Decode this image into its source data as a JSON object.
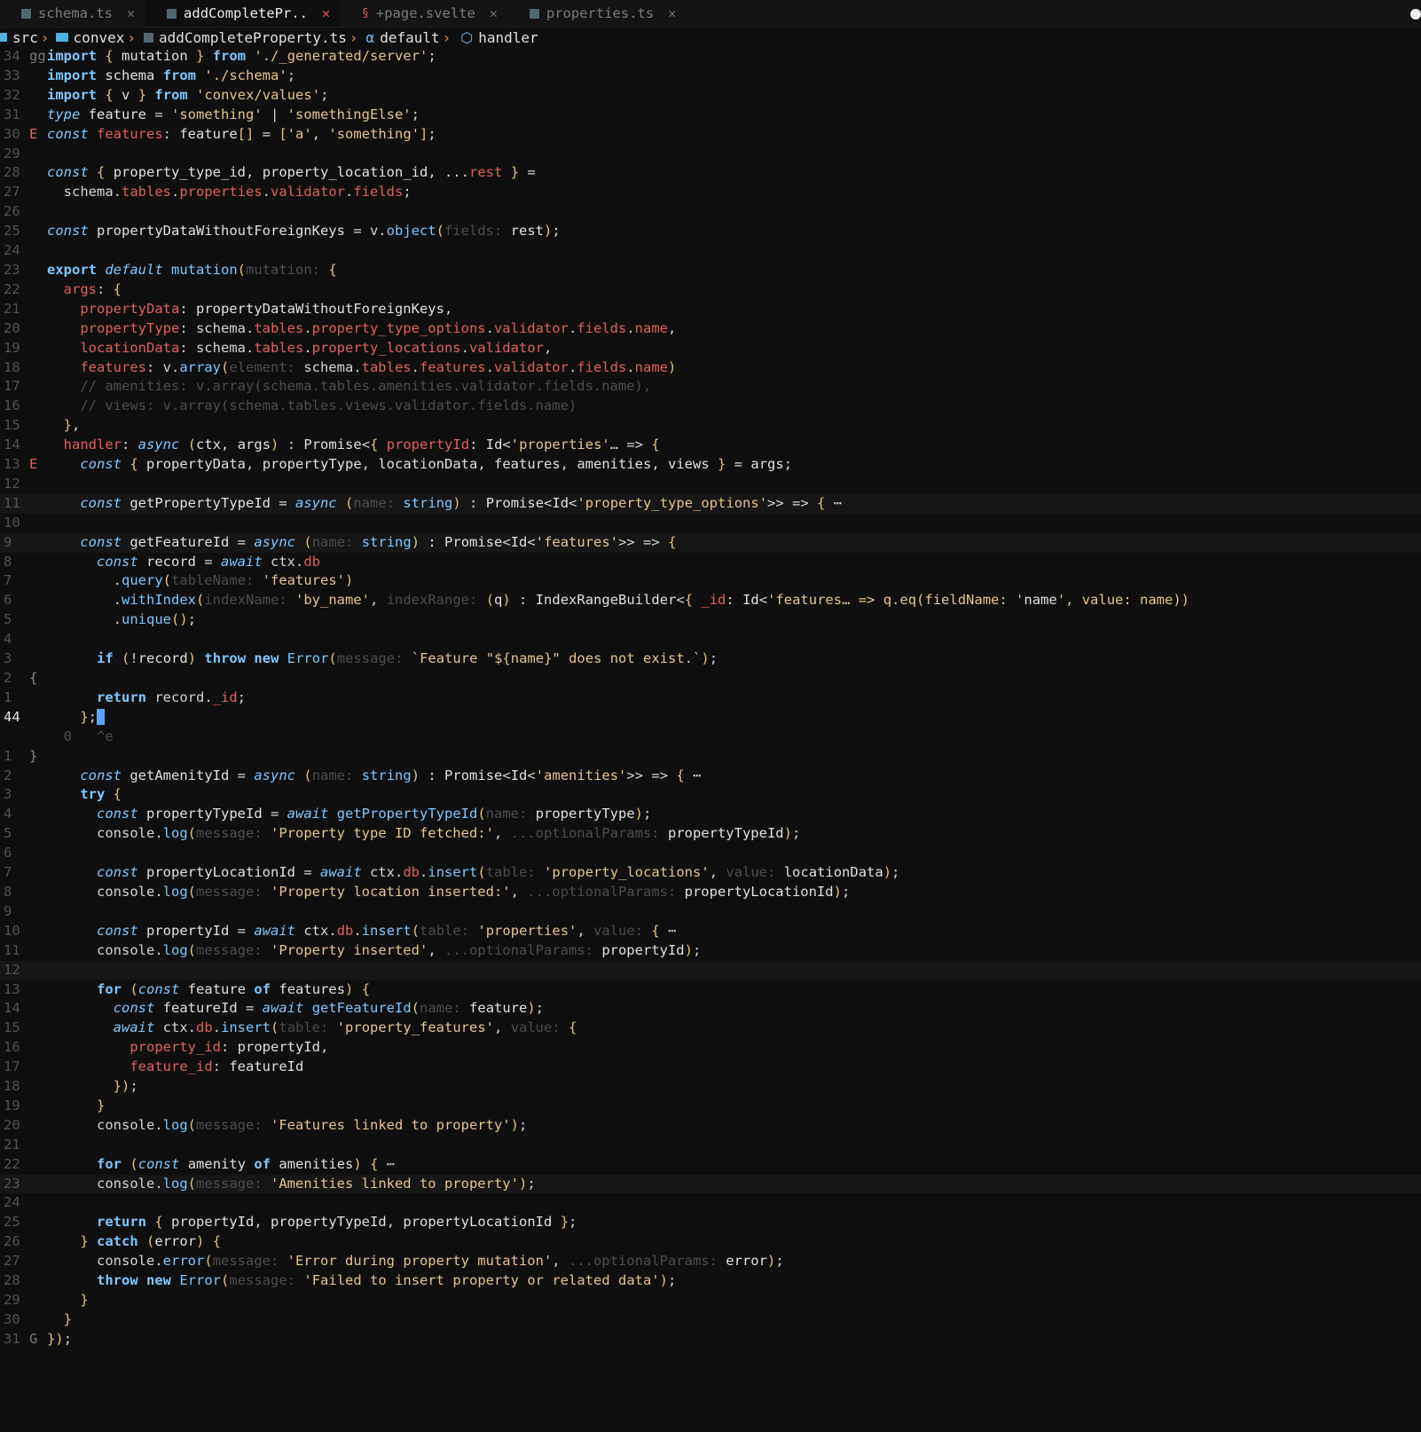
{
  "tabs": [
    {
      "label": "schema.ts",
      "icon": "ts-icon",
      "active": false
    },
    {
      "label": "addCompletePr..",
      "icon": "ts-icon",
      "active": true
    },
    {
      "label": "+page.svelte",
      "icon": "svelte-icon",
      "active": false
    },
    {
      "label": "properties.ts",
      "icon": "ts-icon",
      "active": false
    }
  ],
  "breadcrumb": {
    "src": "src",
    "folder": "convex",
    "file": "addCompleteProperty.ts",
    "symbol1": "default",
    "symbol2": "handler"
  },
  "colors": {
    "background": "#0f0f0f",
    "keyword": "#7fc7ff",
    "string": "#e5c48e",
    "property": "#e0605a",
    "cursor": "#5aa5ff"
  },
  "lines": [
    {
      "n": "34",
      "g": "gg",
      "t": "import { mutation } from './_generated/server';"
    },
    {
      "n": "33",
      "g": "",
      "t": "import schema from './schema';"
    },
    {
      "n": "32",
      "g": "",
      "t": "import { v } from 'convex/values';"
    },
    {
      "n": "31",
      "g": "",
      "t": "type feature = 'something' | 'somethingElse';"
    },
    {
      "n": "30",
      "g": "E",
      "t": "const features: feature[] = ['a', 'something'];"
    },
    {
      "n": "29",
      "g": "",
      "t": ""
    },
    {
      "n": "28",
      "g": "",
      "t": "const { property_type_id, property_location_id, ...rest } ="
    },
    {
      "n": "27",
      "g": "",
      "t": "  schema.tables.properties.validator.fields;"
    },
    {
      "n": "26",
      "g": "",
      "t": ""
    },
    {
      "n": "25",
      "g": "",
      "t": "const propertyDataWithoutForeignKeys = v.object(fields: rest);"
    },
    {
      "n": "24",
      "g": "",
      "t": ""
    },
    {
      "n": "23",
      "g": "",
      "t": "export default mutation(mutation: {"
    },
    {
      "n": "22",
      "g": "",
      "t": "  args: {"
    },
    {
      "n": "21",
      "g": "",
      "t": "    propertyData: propertyDataWithoutForeignKeys,"
    },
    {
      "n": "20",
      "g": "",
      "t": "    propertyType: schema.tables.property_type_options.validator.fields.name,"
    },
    {
      "n": "19",
      "g": "",
      "t": "    locationData: schema.tables.property_locations.validator,"
    },
    {
      "n": "18",
      "g": "",
      "t": "    features: v.array(element: schema.tables.features.validator.fields.name)"
    },
    {
      "n": "17",
      "g": "",
      "t": "    // amenities: v.array(schema.tables.amenities.validator.fields.name),"
    },
    {
      "n": "16",
      "g": "",
      "t": "    // views: v.array(schema.tables.views.validator.fields.name)"
    },
    {
      "n": "15",
      "g": "",
      "t": "  },"
    },
    {
      "n": "14",
      "g": "",
      "t": "  handler: async (ctx, args) : Promise<{ propertyId: Id<'properties'… => {"
    },
    {
      "n": "13",
      "g": "E",
      "t": "    const { propertyData, propertyType, locationData, features, amenities, views } = args;"
    },
    {
      "n": "12",
      "g": "",
      "t": ""
    },
    {
      "n": "11",
      "g": "",
      "t": "    const getPropertyTypeId = async (name: string) : Promise<Id<'property_type_options'>> => { ⋯"
    },
    {
      "n": "10",
      "g": "",
      "t": ""
    },
    {
      "n": "9",
      "g": "",
      "t": "    const getFeatureId = async (name: string) : Promise<Id<'features'>> => {"
    },
    {
      "n": "8",
      "g": "",
      "t": "      const record = await ctx.db"
    },
    {
      "n": "7",
      "g": "",
      "t": "        .query(tableName: 'features')"
    },
    {
      "n": "6",
      "g": "",
      "t": "        .withIndex(indexName: 'by_name', indexRange: (q) : IndexRangeBuilder<{ _id: Id<'features… => q.eq(fieldName: 'name', value: name))"
    },
    {
      "n": "5",
      "g": "",
      "t": "        .unique();"
    },
    {
      "n": "4",
      "g": "",
      "t": ""
    },
    {
      "n": "3",
      "g": "",
      "t": "      if (!record) throw new Error(message: `Feature \"${name}\" does not exist.`);"
    },
    {
      "n": "2",
      "g": "{",
      "t": ""
    },
    {
      "n": "1",
      "g": "",
      "t": "      return record._id;"
    },
    {
      "n": "44",
      "g": "",
      "t": "    };"
    },
    {
      "n": "",
      "g": "",
      "t": "  0   ^e"
    },
    {
      "n": "1",
      "g": "}",
      "t": ""
    },
    {
      "n": "2",
      "g": "",
      "t": "    const getAmenityId = async (name: string) : Promise<Id<'amenities'>> => { ⋯"
    },
    {
      "n": "3",
      "g": "",
      "t": "    try {"
    },
    {
      "n": "4",
      "g": "",
      "t": "      const propertyTypeId = await getPropertyTypeId(name: propertyType);"
    },
    {
      "n": "5",
      "g": "",
      "t": "      console.log(message: 'Property type ID fetched:', ...optionalParams: propertyTypeId);"
    },
    {
      "n": "6",
      "g": "",
      "t": ""
    },
    {
      "n": "7",
      "g": "",
      "t": "      const propertyLocationId = await ctx.db.insert(table: 'property_locations', value: locationData);"
    },
    {
      "n": "8",
      "g": "",
      "t": "      console.log(message: 'Property location inserted:', ...optionalParams: propertyLocationId);"
    },
    {
      "n": "9",
      "g": "",
      "t": ""
    },
    {
      "n": "10",
      "g": "",
      "t": "      const propertyId = await ctx.db.insert(table: 'properties', value: { ⋯"
    },
    {
      "n": "11",
      "g": "",
      "t": "      console.log(message: 'Property inserted', ...optionalParams: propertyId);"
    },
    {
      "n": "12",
      "g": "",
      "t": ""
    },
    {
      "n": "13",
      "g": "",
      "t": "      for (const feature of features) {"
    },
    {
      "n": "14",
      "g": "",
      "t": "        const featureId = await getFeatureId(name: feature);"
    },
    {
      "n": "15",
      "g": "",
      "t": "        await ctx.db.insert(table: 'property_features', value: {"
    },
    {
      "n": "16",
      "g": "",
      "t": "          property_id: propertyId,"
    },
    {
      "n": "17",
      "g": "",
      "t": "          feature_id: featureId"
    },
    {
      "n": "18",
      "g": "",
      "t": "        });"
    },
    {
      "n": "19",
      "g": "",
      "t": "      }"
    },
    {
      "n": "20",
      "g": "",
      "t": "      console.log(message: 'Features linked to property');"
    },
    {
      "n": "21",
      "g": "",
      "t": ""
    },
    {
      "n": "22",
      "g": "",
      "t": "      for (const amenity of amenities) { ⋯"
    },
    {
      "n": "23",
      "g": "",
      "t": "      console.log(message: 'Amenities linked to property');"
    },
    {
      "n": "24",
      "g": "",
      "t": ""
    },
    {
      "n": "25",
      "g": "",
      "t": "      return { propertyId, propertyTypeId, propertyLocationId };"
    },
    {
      "n": "26",
      "g": "",
      "t": "    } catch (error) {"
    },
    {
      "n": "27",
      "g": "",
      "t": "      console.error(message: 'Error during property mutation', ...optionalParams: error);"
    },
    {
      "n": "28",
      "g": "",
      "t": "      throw new Error(message: 'Failed to insert property or related data');"
    },
    {
      "n": "29",
      "g": "",
      "t": "    }"
    },
    {
      "n": "30",
      "g": "",
      "t": "  }"
    },
    {
      "n": "31",
      "g": "G",
      "t": "});"
    }
  ]
}
